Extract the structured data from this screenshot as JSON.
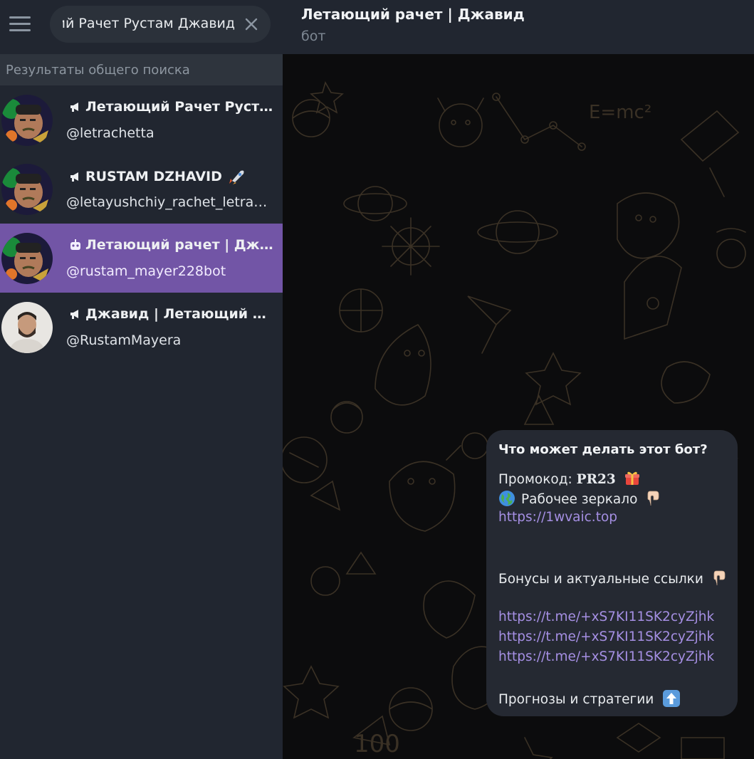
{
  "search": {
    "value": "ций Рачет Рустам Джавид",
    "section_header": "Результаты общего поиска"
  },
  "results": [
    {
      "type": "channel",
      "name": "Летающий Рачет Руста...",
      "username": "@letrachetta",
      "suffix_emoji": "",
      "avatar": "cartoon"
    },
    {
      "type": "channel",
      "name": "RUSTAM DZHAVID",
      "username": "@letayushchiy_rachet_letrac...",
      "suffix_emoji": "rocket",
      "avatar": "cartoon"
    },
    {
      "type": "bot",
      "name": "Летающий рачет | Джа...",
      "username": "@rustam_mayer228bot",
      "suffix_emoji": "",
      "avatar": "cartoon",
      "active": true
    },
    {
      "type": "channel",
      "name": "Джавид | Летающий Р...",
      "username": "@RustamMayera",
      "suffix_emoji": "",
      "avatar": "photo"
    }
  ],
  "chat": {
    "title": "Летающий рачет | Джавид",
    "status": "бот"
  },
  "bot_info": {
    "title": "Что может делать этот бот?",
    "promo_label": "Промокод:",
    "promo_code": "PR23",
    "mirror_label": "Рабочее зеркало",
    "mirror_link": "https://1wvaic.top",
    "bonus_label": "Бонусы и актуальные ссылки",
    "links": [
      "https://t.me/+xS7KI11SK2cyZjhk",
      "https://t.me/+xS7KI11SK2cyZjhk",
      "https://t.me/+xS7KI11SK2cyZjhk"
    ],
    "footer": "Прогнозы и стратегии"
  },
  "colors": {
    "sidebar_bg": "#212630",
    "active_item": "#7255a6",
    "link": "#a58fe3",
    "bubble_bg": "#252932"
  }
}
